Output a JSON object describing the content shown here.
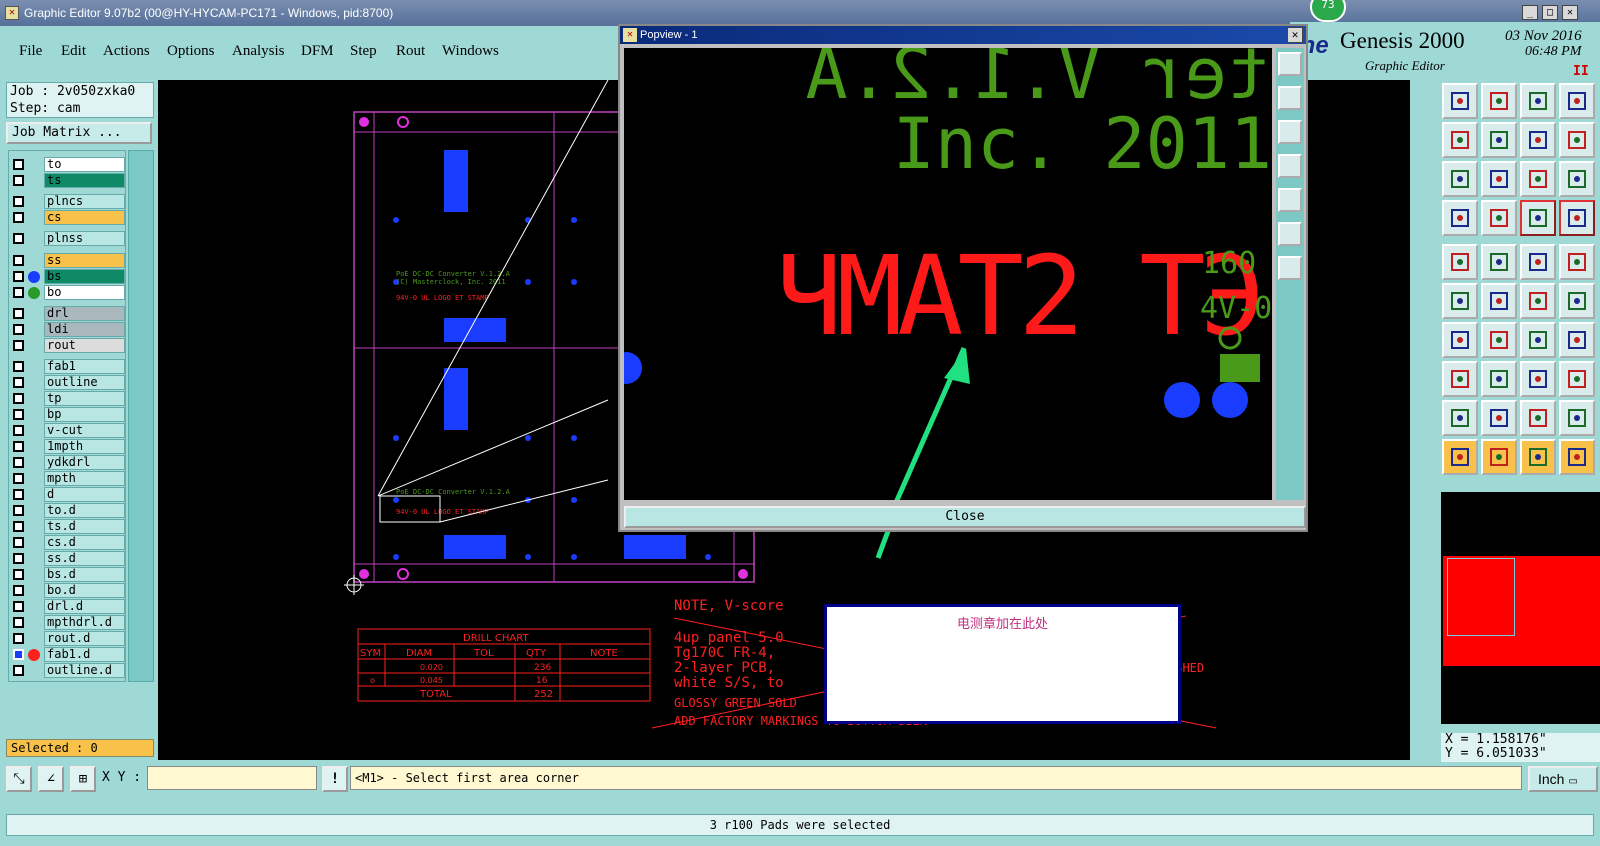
{
  "window": {
    "title": "Graphic Editor 9.07b2 (00@HY-HYCAM-PC171 - Windows, pid:8700)",
    "badge": "73",
    "brand_name": "Genesis 2000",
    "brand_sub": "Graphic Editor",
    "brand_partial": "ine",
    "date": "03 Nov 2016",
    "time": "06:48 PM"
  },
  "menu": [
    "File",
    "Edit",
    "Actions",
    "Options",
    "Analysis",
    "DFM",
    "Step",
    "Rout",
    "Windows"
  ],
  "job": {
    "job_label": "Job : 2v050zxka0",
    "step_label": "Step: cam",
    "matrix_button": "Job Matrix ..."
  },
  "layers": [
    {
      "name": "to",
      "color": "#ffffff"
    },
    {
      "name": "ts",
      "color": "#0f8a66"
    },
    {
      "name": "plncs",
      "color": "#b8e6e3"
    },
    {
      "name": "cs",
      "color": "#f8c24a"
    },
    {
      "name": "plnss",
      "color": "#b8e6e3"
    },
    {
      "name": "ss",
      "color": "#f8c24a"
    },
    {
      "name": "bs",
      "color": "#0f8a66",
      "dot": "#1a3cff"
    },
    {
      "name": "bo",
      "color": "#ffffff",
      "dot": "#2a9a2a"
    },
    {
      "name": "drl",
      "color": "#a8b8bc"
    },
    {
      "name": "ldi",
      "color": "#a8b8bc"
    },
    {
      "name": "rout",
      "color": "#dcdcdc"
    },
    {
      "name": "fab1",
      "color": "#b8e6e3"
    },
    {
      "name": "outline",
      "color": "#b8e6e3"
    },
    {
      "name": "tp",
      "color": "#b8e6e3"
    },
    {
      "name": "bp",
      "color": "#b8e6e3"
    },
    {
      "name": "v-cut",
      "color": "#b8e6e3"
    },
    {
      "name": "1mpth",
      "color": "#b8e6e3"
    },
    {
      "name": "ydkdrl",
      "color": "#b8e6e3"
    },
    {
      "name": "mpth",
      "color": "#b8e6e3"
    },
    {
      "name": "d",
      "color": "#b8e6e3"
    },
    {
      "name": "to.d",
      "color": "#b8e6e3"
    },
    {
      "name": "ts.d",
      "color": "#b8e6e3"
    },
    {
      "name": "cs.d",
      "color": "#b8e6e3"
    },
    {
      "name": "ss.d",
      "color": "#b8e6e3"
    },
    {
      "name": "bs.d",
      "color": "#b8e6e3"
    },
    {
      "name": "bo.d",
      "color": "#b8e6e3"
    },
    {
      "name": "drl.d",
      "color": "#b8e6e3"
    },
    {
      "name": "mpthdrl.d",
      "color": "#b8e6e3"
    },
    {
      "name": "rout.d",
      "color": "#b8e6e3"
    },
    {
      "name": "fab1.d",
      "color": "#b8e6e3",
      "dot": "#ff2020",
      "active": true
    },
    {
      "name": "outline.d",
      "color": "#b8e6e3"
    }
  ],
  "selected_label": "Selected : 0",
  "bottom": {
    "xy_label": "X Y :",
    "prompt": "<M1> - Select first area corner",
    "unit": "Inch",
    "status": "3 r100 Pads were selected",
    "alert": "!"
  },
  "coords": {
    "x": "X = 1.158176\"",
    "y": "Y = 6.051033\""
  },
  "popview": {
    "title": "Popview - 1",
    "close_label": "Close",
    "text_line1": "ter V.1.2.A",
    "text_line2": "Inc. 2011",
    "text_stamp": "ET STAMP",
    "text_mirror": "ЧМАТ2 ТЭ",
    "side_a": "160",
    "side_b": "4V-0"
  },
  "note_popup": "电测章加在此处",
  "drawing": {
    "drill_chart_title": "DRILL CHART",
    "drill_headers": [
      "SYM",
      "DIAM",
      "TOL",
      "QTY",
      "NOTE"
    ],
    "drill_rows": [
      [
        "",
        "0.020",
        "",
        "236",
        ""
      ],
      [
        "o",
        "0.045",
        "",
        "16",
        ""
      ]
    ],
    "drill_total": [
      "TOTAL",
      "252"
    ],
    "note_title": "NOTE, V-score",
    "note_lines": [
      "4up panel 5.0",
      "Tg170C FR-4,",
      "2-layer PCB,",
      "white S/S, to",
      "GLOSSY GREEN SOLD",
      "ADD FACTORY MARKINGS TO BOTTOM SILK"
    ],
    "note_suffix": [
      "h",
      "",
      "ISHED",
      "",
      "",
      ""
    ],
    "board_text": [
      "PoE DC-DC Converter V.1.2.A",
      "(C) Masterclock, Inc. 2011",
      "94V-0 UL LOGO ET STAMP"
    ]
  }
}
